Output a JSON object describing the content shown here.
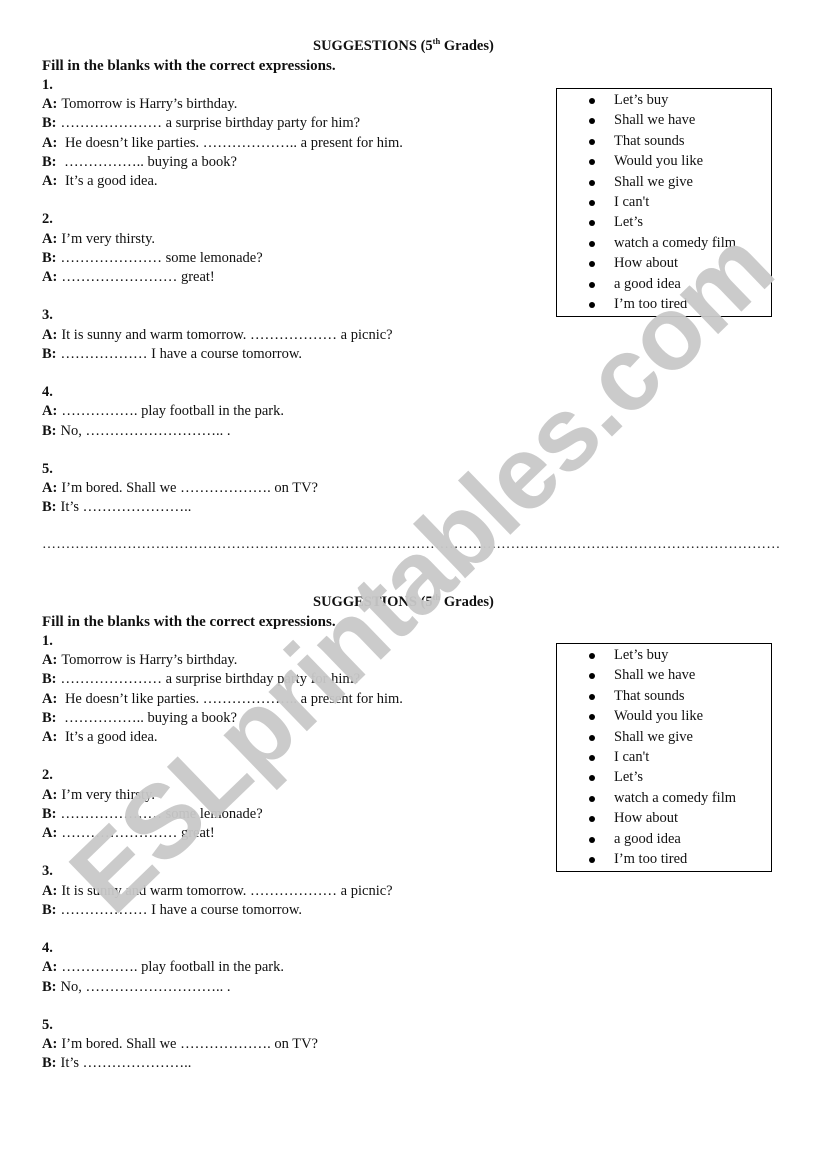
{
  "watermark": "ESLprintables.com",
  "divider_text": "……………………………………………………………………………………………………………………………………………….",
  "worksheets": [
    {
      "title": {
        "prefix": "SUGGESTIONS (5",
        "superscript": "th",
        "suffix": " Grades)"
      },
      "instruction": "Fill in the blanks with the correct expressions.",
      "exercises": [
        {
          "number": "1.",
          "lines": [
            {
              "speaker": "A:",
              "text": "Tomorrow is Harry’s birthday."
            },
            {
              "speaker": "B:",
              "text": "…………………  a surprise birthday party for him?"
            },
            {
              "speaker": "A:",
              "text": " He doesn’t like parties. ……………….. a present for him."
            },
            {
              "speaker": "B:",
              "text": " …………….. buying a book?"
            },
            {
              "speaker": "A:",
              "text": " It’s a good idea."
            }
          ]
        },
        {
          "number": "2.",
          "lines": [
            {
              "speaker": "A:",
              "text": "I’m very thirsty."
            },
            {
              "speaker": "B:",
              "text": "………………… some lemonade?"
            },
            {
              "speaker": "A:",
              "text": "…………………… great!"
            }
          ]
        },
        {
          "number": "3.",
          "lines": [
            {
              "speaker": "A:",
              "text": "It is sunny and warm tomorrow. ………………  a picnic?"
            },
            {
              "speaker": "B:",
              "text": "……………… I have a course tomorrow."
            }
          ]
        },
        {
          "number": "4.",
          "lines": [
            {
              "speaker": "A:",
              "text": "……………. play football in the park."
            },
            {
              "speaker": "B:",
              "text": "No, ……………………….. ."
            }
          ]
        },
        {
          "number": "5.",
          "lines": [
            {
              "speaker": "A:",
              "text": "I’m bored. Shall we ………………. on TV?"
            },
            {
              "speaker": "B:",
              "text": "It’s ………………….."
            }
          ]
        }
      ],
      "word_box": [
        "Let’s buy",
        "Shall we have",
        "That sounds",
        "Would you like",
        "Shall we give",
        "I can't",
        "Let’s",
        "watch a comedy film",
        "How about",
        "a good idea",
        "I’m too tired"
      ]
    },
    {
      "title": {
        "prefix": "SUGGESTIONS (5",
        "superscript": "th",
        "suffix": " Grades)"
      },
      "instruction": "Fill in the blanks with the correct expressions.",
      "exercises": [
        {
          "number": "1.",
          "lines": [
            {
              "speaker": "A:",
              "text": "Tomorrow is Harry’s birthday."
            },
            {
              "speaker": "B:",
              "text": "…………………  a surprise birthday party for him?"
            },
            {
              "speaker": "A:",
              "text": " He doesn’t like parties. ……………….. a present for him."
            },
            {
              "speaker": "B:",
              "text": " …………….. buying a book?"
            },
            {
              "speaker": "A:",
              "text": " It’s a good idea."
            }
          ]
        },
        {
          "number": "2.",
          "lines": [
            {
              "speaker": "A:",
              "text": "I’m very thirsty."
            },
            {
              "speaker": "B:",
              "text": "………………… some lemonade?"
            },
            {
              "speaker": "A:",
              "text": "…………………… great!"
            }
          ]
        },
        {
          "number": "3.",
          "lines": [
            {
              "speaker": "A:",
              "text": "It is sunny and warm tomorrow. ………………  a picnic?"
            },
            {
              "speaker": "B:",
              "text": "……………… I have a course tomorrow."
            }
          ]
        },
        {
          "number": "4.",
          "lines": [
            {
              "speaker": "A:",
              "text": "……………. play football in the park."
            },
            {
              "speaker": "B:",
              "text": "No, ……………………….. ."
            }
          ]
        },
        {
          "number": "5.",
          "lines": [
            {
              "speaker": "A:",
              "text": "I’m bored. Shall we ………………. on TV?"
            },
            {
              "speaker": "B:",
              "text": "It’s ………………….."
            }
          ]
        }
      ],
      "word_box": [
        "Let’s buy",
        "Shall we have",
        "That sounds",
        "Would you like",
        "Shall we give",
        "I can't",
        "Let’s",
        "watch a comedy film",
        "How about",
        "a good idea",
        "I’m too tired"
      ]
    }
  ]
}
